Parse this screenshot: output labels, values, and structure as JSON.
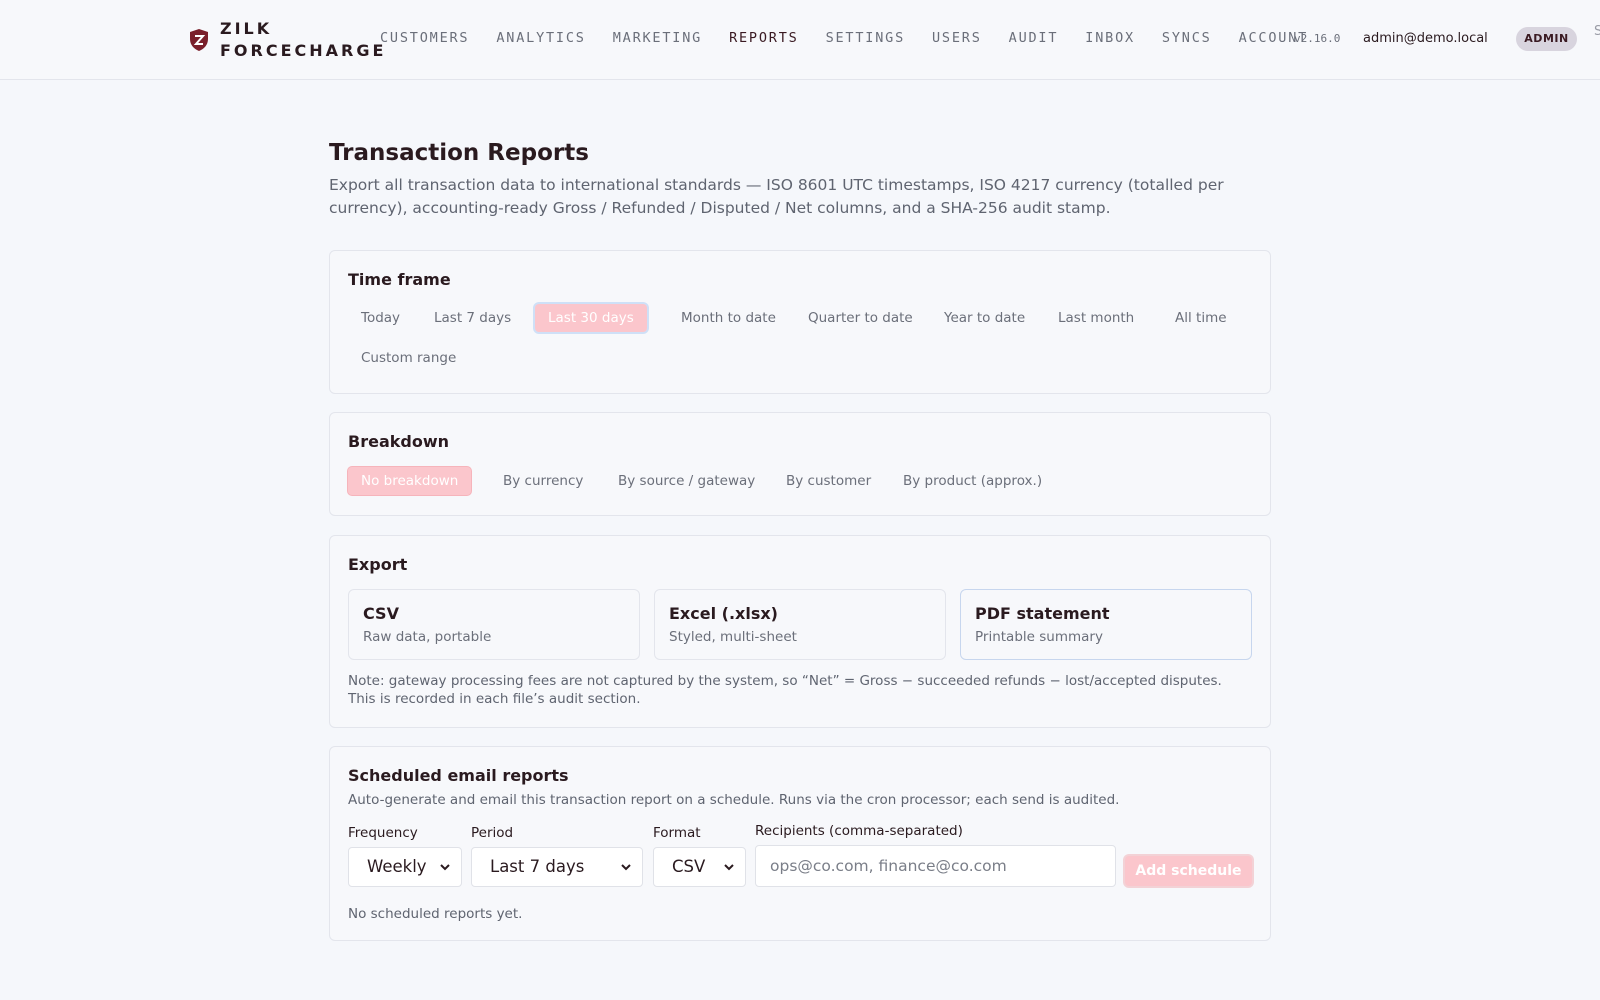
{
  "brand": {
    "line1": "ZILK",
    "line2": "FORCECHARGE",
    "accent": "#7a1f2b"
  },
  "nav": {
    "items": [
      "CUSTOMERS",
      "ANALYTICS",
      "MARKETING",
      "REPORTS",
      "SETTINGS",
      "USERS",
      "AUDIT",
      "INBOX",
      "SYNCS",
      "ACCOUNT"
    ],
    "active": "REPORTS"
  },
  "header": {
    "version": "v2.16.0",
    "user_email": "admin@demo.local",
    "role": "ADMIN",
    "overflow": "S"
  },
  "page": {
    "title": "Transaction Reports",
    "description": "Export all transaction data to international standards — ISO 8601 UTC timestamps, ISO 4217 currency (totalled per currency), accounting-ready Gross / Refunded / Disputed / Net columns, and a SHA-256 audit stamp."
  },
  "timeframe": {
    "title": "Time frame",
    "options": [
      "Today",
      "Last 7 days",
      "Last 30 days",
      "Month to date",
      "Quarter to date",
      "Year to date",
      "Last month",
      "All time",
      "Custom range"
    ],
    "selected": "Last 30 days"
  },
  "breakdown": {
    "title": "Breakdown",
    "options": [
      "No breakdown",
      "By currency",
      "By source / gateway",
      "By customer",
      "By product (approx.)"
    ],
    "selected": "No breakdown"
  },
  "export": {
    "title": "Export",
    "options": [
      {
        "title": "CSV",
        "subtitle": "Raw data, portable"
      },
      {
        "title": "Excel (.xlsx)",
        "subtitle": "Styled, multi-sheet"
      },
      {
        "title": "PDF statement",
        "subtitle": "Printable summary"
      }
    ],
    "note": "Note: gateway processing fees are not captured by the system, so “Net” = Gross − succeeded refunds − lost/accepted disputes. This is recorded in each file’s audit section."
  },
  "schedule": {
    "title": "Scheduled email reports",
    "description": "Auto-generate and email this transaction report on a schedule. Runs via the cron processor; each send is audited.",
    "frequency": {
      "label": "Frequency",
      "value": "Weekly"
    },
    "period": {
      "label": "Period",
      "value": "Last 7 days"
    },
    "format": {
      "label": "Format",
      "value": "CSV"
    },
    "recipients": {
      "label": "Recipients (comma-separated)",
      "placeholder": "ops@co.com, finance@co.com"
    },
    "add_label": "Add schedule",
    "empty": "No scheduled reports yet."
  },
  "colors": {
    "selected_chip": "#fbc6cc",
    "text": "#2a1a1f",
    "muted": "#6b6f7a"
  }
}
